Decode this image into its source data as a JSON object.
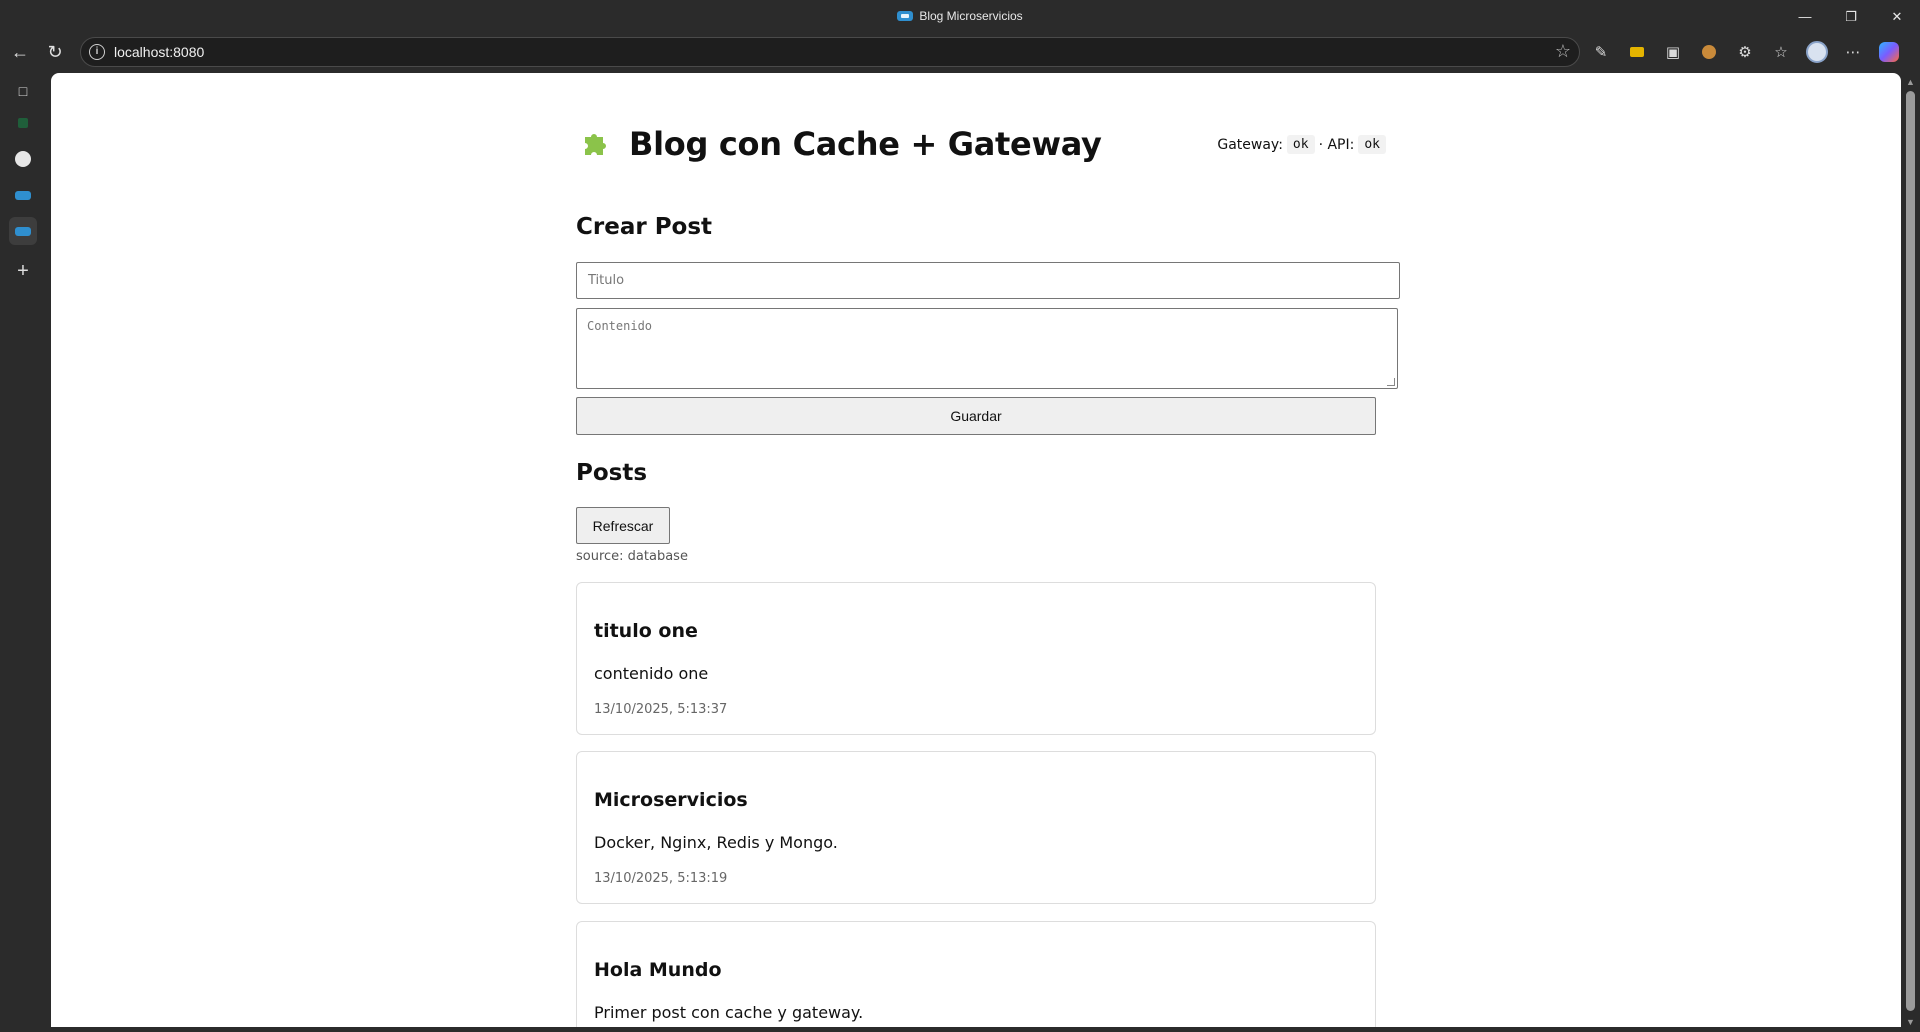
{
  "browser": {
    "window_title": "Blog Microservicios",
    "url": "localhost:8080",
    "window_controls": [
      "minimize",
      "restore",
      "close"
    ]
  },
  "page": {
    "title": "Blog con Cache + Gateway",
    "status": {
      "gateway_label": "Gateway:",
      "gateway_value": "ok",
      "api_label": "· API:",
      "api_value": "ok"
    },
    "create": {
      "heading": "Crear Post",
      "title_placeholder": "Titulo",
      "content_placeholder": "Contenido",
      "save_label": "Guardar"
    },
    "posts_section": {
      "heading": "Posts",
      "refresh_label": "Refrescar",
      "source_text": "source: database"
    },
    "posts": [
      {
        "title": "titulo one",
        "content": "contenido one",
        "date": "13/10/2025, 5:13:37"
      },
      {
        "title": "Microservicios",
        "content": "Docker, Nginx, Redis y Mongo.",
        "date": "13/10/2025, 5:13:19"
      },
      {
        "title": "Hola Mundo",
        "content": "Primer post con cache y gateway.",
        "date": ""
      }
    ]
  },
  "icons": {
    "logo": "puzzle-piece-icon",
    "accent": "#8bc34a"
  }
}
